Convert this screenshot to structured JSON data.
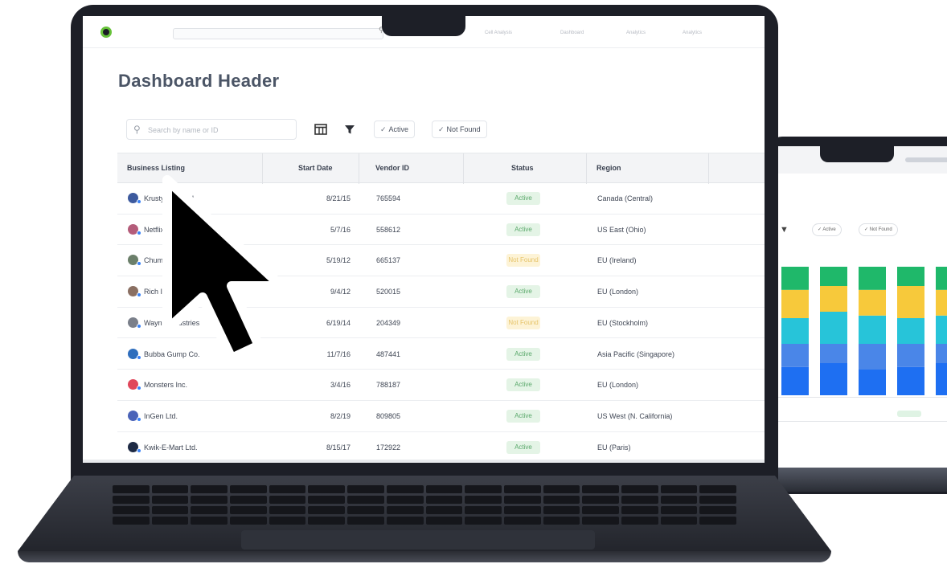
{
  "app": {
    "nav_tabs": [
      "Cell Analysis",
      "Dashboard",
      "Analytics",
      "Analytics"
    ],
    "colors": {
      "accent": "#67c23a",
      "active_bg": "#e4f4e6",
      "active_text": "#5aa86b",
      "notfound_bg": "#fdf3d6",
      "notfound_text": "#e6c46a"
    }
  },
  "page": {
    "title": "Dashboard Header"
  },
  "toolbar": {
    "search_placeholder": "Search by name or ID",
    "columns_icon": "columns-icon",
    "filter_icon": "filter-icon",
    "chips": [
      {
        "label": "Active",
        "checked": true
      },
      {
        "label": "Not Found",
        "checked": true
      }
    ]
  },
  "table": {
    "columns": [
      "Business Listing",
      "Start Date",
      "Vendor ID",
      "Status",
      "Region"
    ],
    "rows": [
      {
        "business": "Krusty Krab Ltd.",
        "start": "8/21/15",
        "vendor": "765594",
        "status": "Active",
        "region": "Canada (Central)",
        "avatar": "#3d5a9e"
      },
      {
        "business": "Netflix",
        "start": "5/7/16",
        "vendor": "558612",
        "status": "Active",
        "region": "US East (Ohio)",
        "avatar": "#b45c7a"
      },
      {
        "business": "Chums",
        "start": "5/19/12",
        "vendor": "665137",
        "status": "Not Found",
        "region": "EU (Ireland)",
        "avatar": "#6b7f6a"
      },
      {
        "business": "Rich Industries",
        "start": "9/4/12",
        "vendor": "520015",
        "status": "Active",
        "region": "EU (London)",
        "avatar": "#8a6f62"
      },
      {
        "business": "Wayne Industries",
        "start": "6/19/14",
        "vendor": "204349",
        "status": "Not Found",
        "region": "EU (Stockholm)",
        "avatar": "#7a7f8a"
      },
      {
        "business": "Bubba Gump Co.",
        "start": "11/7/16",
        "vendor": "487441",
        "status": "Active",
        "region": "Asia Pacific (Singapore)",
        "avatar": "#2f6ebd"
      },
      {
        "business": "Monsters Inc.",
        "start": "3/4/16",
        "vendor": "788187",
        "status": "Active",
        "region": "EU (London)",
        "avatar": "#e0475b"
      },
      {
        "business": "InGen Ltd.",
        "start": "8/2/19",
        "vendor": "809805",
        "status": "Active",
        "region": "US West (N. California)",
        "avatar": "#4a63b8"
      },
      {
        "business": "Kwik-E-Mart Ltd.",
        "start": "8/15/17",
        "vendor": "172922",
        "status": "Active",
        "region": "EU (Paris)",
        "avatar": "#1e2a44"
      }
    ]
  },
  "secondary_screen": {
    "chips": [
      "Active",
      "Not Found"
    ],
    "chart_data": {
      "type": "bar",
      "stacked": true,
      "series_colors": [
        "#1e6ff2",
        "#4a86e8",
        "#27c4d9",
        "#f7c93b",
        "#1fb86a"
      ],
      "bars": [
        [
          0.22,
          0.18,
          0.2,
          0.22,
          0.18
        ],
        [
          0.25,
          0.15,
          0.25,
          0.2,
          0.15
        ],
        [
          0.2,
          0.2,
          0.22,
          0.2,
          0.18
        ],
        [
          0.22,
          0.18,
          0.2,
          0.25,
          0.15
        ],
        [
          0.25,
          0.15,
          0.22,
          0.2,
          0.18
        ]
      ]
    }
  }
}
